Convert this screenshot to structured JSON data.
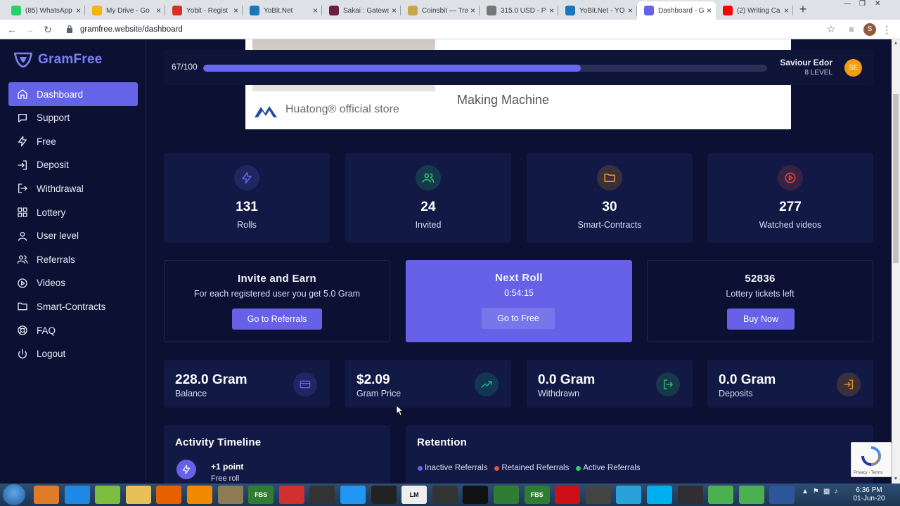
{
  "browser": {
    "tabs": [
      {
        "title": "(85) WhatsApp",
        "favicon": "whatsapp-icon",
        "color": "#25d366"
      },
      {
        "title": "My Drive - Go",
        "favicon": "google-drive-icon",
        "color": "#f4b400"
      },
      {
        "title": "Yobit - Regist",
        "favicon": "gmail-icon",
        "color": "#d93025"
      },
      {
        "title": "YoBit.Net",
        "favicon": "yobit-icon",
        "color": "#1b75bb"
      },
      {
        "title": "Sakai : Gatewa",
        "favicon": "sakai-icon",
        "color": "#6b1e3f"
      },
      {
        "title": "Coinsbit — Tra",
        "favicon": "coinsbit-icon",
        "color": "#c8a64b"
      },
      {
        "title": "315.0 USD - Pr",
        "favicon": "bitcoin-icon",
        "color": "#777777"
      },
      {
        "title": "YoBit.Net - YO",
        "favicon": "yobit-icon",
        "color": "#1b75bb"
      },
      {
        "title": "Dashboard - G",
        "favicon": "gramfree-icon",
        "color": "#6563e8",
        "active": true
      },
      {
        "title": "(2) Writing Ca",
        "favicon": "youtube-icon",
        "color": "#ff0000"
      }
    ],
    "new_tab": "+",
    "url": "gramfree.website/dashboard",
    "profile_initial": "S"
  },
  "sidebar": {
    "brand": "GramFree",
    "items": [
      {
        "label": "Dashboard",
        "icon": "home-icon",
        "active": true
      },
      {
        "label": "Support",
        "icon": "chat-icon"
      },
      {
        "label": "Free",
        "icon": "lightning-icon"
      },
      {
        "label": "Deposit",
        "icon": "login-icon"
      },
      {
        "label": "Withdrawal",
        "icon": "logout-arrow-icon"
      },
      {
        "label": "Lottery",
        "icon": "grid-icon"
      },
      {
        "label": "User level",
        "icon": "user-icon"
      },
      {
        "label": "Referrals",
        "icon": "users-icon"
      },
      {
        "label": "Videos",
        "icon": "play-circle-icon"
      },
      {
        "label": "Smart-Contracts",
        "icon": "folder-icon"
      },
      {
        "label": "FAQ",
        "icon": "lifebuoy-icon"
      },
      {
        "label": "Logout",
        "icon": "power-icon"
      }
    ]
  },
  "ad": {
    "store": "Huatong® official store",
    "machine": "Making Machine"
  },
  "progress": {
    "text": "67/100",
    "fraction": 0.67,
    "user_name": "Saviour Edor",
    "user_level": "8 LEVEL",
    "avatar_initials": "SE"
  },
  "stats": [
    {
      "value": "131",
      "label": "Rolls",
      "icon": "lightning-icon",
      "color": "#6563e8"
    },
    {
      "value": "24",
      "label": "Invited",
      "icon": "users-icon",
      "color": "#2ecc71"
    },
    {
      "value": "30",
      "label": "Smart-Contracts",
      "icon": "folder-icon",
      "color": "#f39c12"
    },
    {
      "value": "277",
      "label": "Watched videos",
      "icon": "play-circle-icon",
      "color": "#e74c3c"
    }
  ],
  "cards": {
    "invite": {
      "title": "Invite and Earn",
      "subtitle": "For each registered user you get 5.0 Gram",
      "button": "Go to Referrals"
    },
    "roll": {
      "title": "Next Roll",
      "timer": "0:54:15",
      "button": "Go to Free"
    },
    "lottery": {
      "title": "52836",
      "subtitle": "Lottery tickets left",
      "button": "Buy Now"
    }
  },
  "balances": [
    {
      "value": "228.0 Gram",
      "label": "Balance",
      "icon": "credit-card-icon",
      "color": "#6563e8"
    },
    {
      "value": "$2.09",
      "label": "Gram Price",
      "icon": "trending-up-icon",
      "color": "#1abc9c"
    },
    {
      "value": "0.0 Gram",
      "label": "Withdrawn",
      "icon": "logout-arrow-icon",
      "color": "#2ecc71"
    },
    {
      "value": "0.0 Gram",
      "label": "Deposits",
      "icon": "login-icon",
      "color": "#f39c12"
    }
  ],
  "timeline": {
    "title": "Activity Timeline",
    "item_title": "+1 point",
    "item_sub": "Free roll"
  },
  "retention": {
    "title": "Retention",
    "legend": [
      {
        "label": "Inactive Referrals",
        "color": "#6563e8"
      },
      {
        "label": "Retained Referrals",
        "color": "#e74c3c"
      },
      {
        "label": "Active Referrals",
        "color": "#2ecc71"
      }
    ]
  },
  "recaptcha": {
    "text": "Privacy - Terms"
  },
  "taskbar": {
    "clock_time": "6:36 PM",
    "clock_date": "01-Jun-20",
    "apps": [
      "FBS",
      "FBS",
      "LM"
    ]
  }
}
